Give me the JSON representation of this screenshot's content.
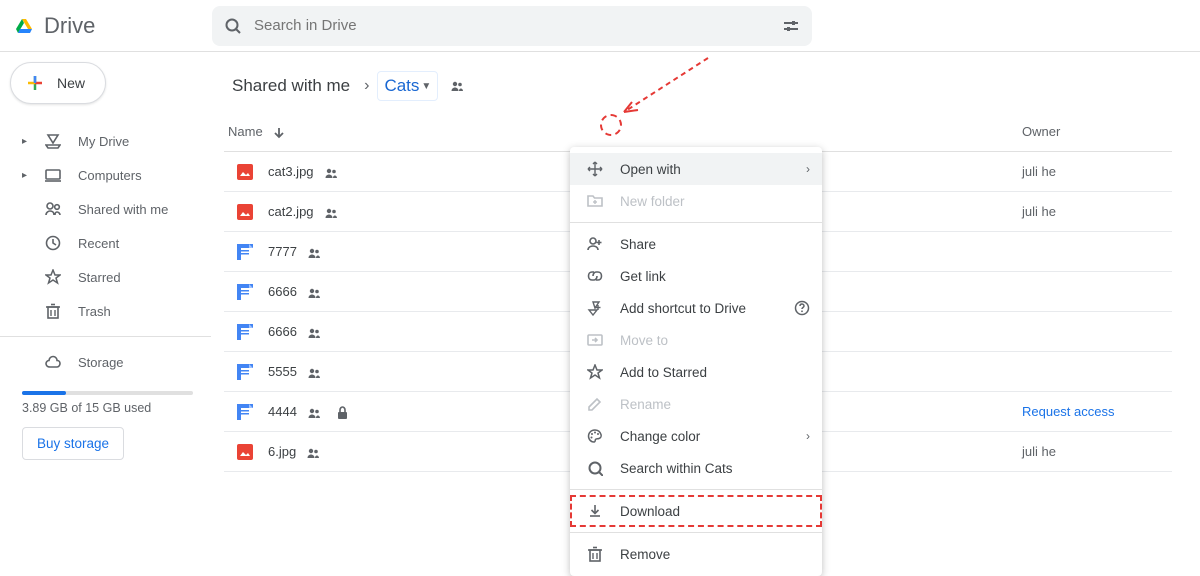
{
  "brand": {
    "name": "Drive"
  },
  "search": {
    "placeholder": "Search in Drive"
  },
  "sidebar": {
    "new_label": "New",
    "items": [
      {
        "label": "My Drive",
        "icon": "my-drive-icon",
        "has_caret": true
      },
      {
        "label": "Computers",
        "icon": "computers-icon",
        "has_caret": true
      },
      {
        "label": "Shared with me",
        "icon": "shared-icon",
        "has_caret": false
      },
      {
        "label": "Recent",
        "icon": "recent-icon",
        "has_caret": false
      },
      {
        "label": "Starred",
        "icon": "star-icon",
        "has_caret": false
      },
      {
        "label": "Trash",
        "icon": "trash-icon",
        "has_caret": false
      }
    ],
    "storage_label": "Storage",
    "storage_used": "3.89 GB of 15 GB used",
    "buy_label": "Buy storage"
  },
  "breadcrumb": {
    "root": "Shared with me",
    "current": "Cats"
  },
  "columns": {
    "name": "Name",
    "owner": "Owner"
  },
  "files": [
    {
      "name": "cat3.jpg",
      "kind": "image",
      "owner": "juli he",
      "shared": true,
      "locked": false
    },
    {
      "name": "cat2.jpg",
      "kind": "image",
      "owner": "juli he",
      "shared": true,
      "locked": false
    },
    {
      "name": "7777",
      "kind": "doc",
      "owner": "",
      "shared": true,
      "locked": false
    },
    {
      "name": "6666",
      "kind": "doc",
      "owner": "",
      "shared": true,
      "locked": false
    },
    {
      "name": "6666",
      "kind": "doc",
      "owner": "",
      "shared": true,
      "locked": false
    },
    {
      "name": "5555",
      "kind": "doc",
      "owner": "",
      "shared": true,
      "locked": false
    },
    {
      "name": "4444",
      "kind": "doc",
      "owner": "Request access",
      "owner_link": true,
      "shared": true,
      "locked": true
    },
    {
      "name": "6.jpg",
      "kind": "image",
      "owner": "juli he",
      "shared": true,
      "locked": false
    }
  ],
  "context_menu": {
    "open_with": "Open with",
    "new_folder": "New folder",
    "share": "Share",
    "get_link": "Get link",
    "add_shortcut": "Add shortcut to Drive",
    "move_to": "Move to",
    "add_starred": "Add to Starred",
    "rename": "Rename",
    "change_color": "Change color",
    "search_within": "Search within Cats",
    "download": "Download",
    "remove": "Remove"
  }
}
